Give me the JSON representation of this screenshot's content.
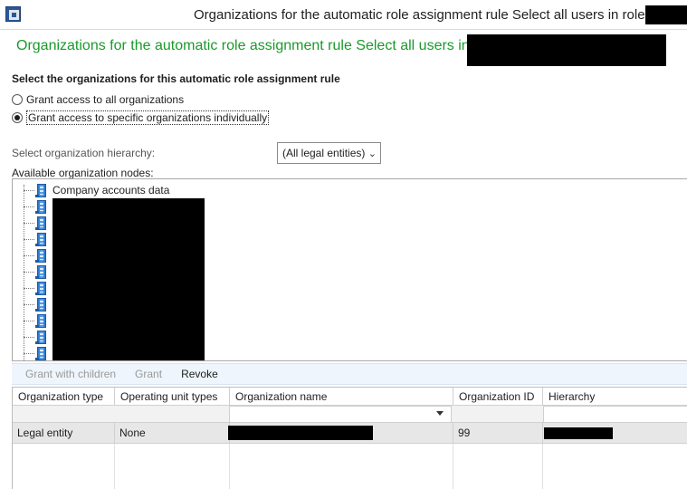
{
  "window": {
    "title": "Organizations for the automatic role assignment rule Select all users in role"
  },
  "form": {
    "title": "Organizations for the automatic role assignment rule Select all users in role",
    "section_heading": "Select the organizations for this automatic role assignment rule",
    "options": [
      {
        "label": "Grant access to all organizations",
        "selected": false
      },
      {
        "label": "Grant access to specific organizations individually",
        "selected": true
      }
    ],
    "hierarchy_label": "Select organization hierarchy:",
    "hierarchy_value": "(All legal entities)",
    "nodes_label": "Available organization nodes:"
  },
  "tree": {
    "nodes": [
      {
        "label": "Company accounts data"
      },
      {
        "label": ""
      },
      {
        "label": ""
      },
      {
        "label": ""
      },
      {
        "label": ""
      },
      {
        "label": ""
      },
      {
        "label": ""
      },
      {
        "label": ""
      },
      {
        "label": ""
      },
      {
        "label": ""
      },
      {
        "label": ""
      }
    ]
  },
  "toolbar": {
    "grant_with_children": "Grant with children",
    "grant": "Grant",
    "revoke": "Revoke"
  },
  "grid": {
    "columns": [
      "Organization type",
      "Operating unit types",
      "Organization name",
      "Organization ID",
      "Hierarchy"
    ],
    "rows": [
      {
        "organization_type": "Legal entity",
        "operating_unit_types": "None",
        "organization_name": "",
        "organization_id": "99",
        "hierarchy": ""
      }
    ]
  },
  "colors": {
    "form_title": "#1a9a2c",
    "toolbar_bg": "#eef5fc",
    "selected_row_bg": "#e7e7e7",
    "redaction": "#000000"
  },
  "icons": {
    "app": "dynamics-ax-app-icon",
    "tree_node": "organization-building-icon",
    "select_arrow": "chevron-down-icon"
  }
}
